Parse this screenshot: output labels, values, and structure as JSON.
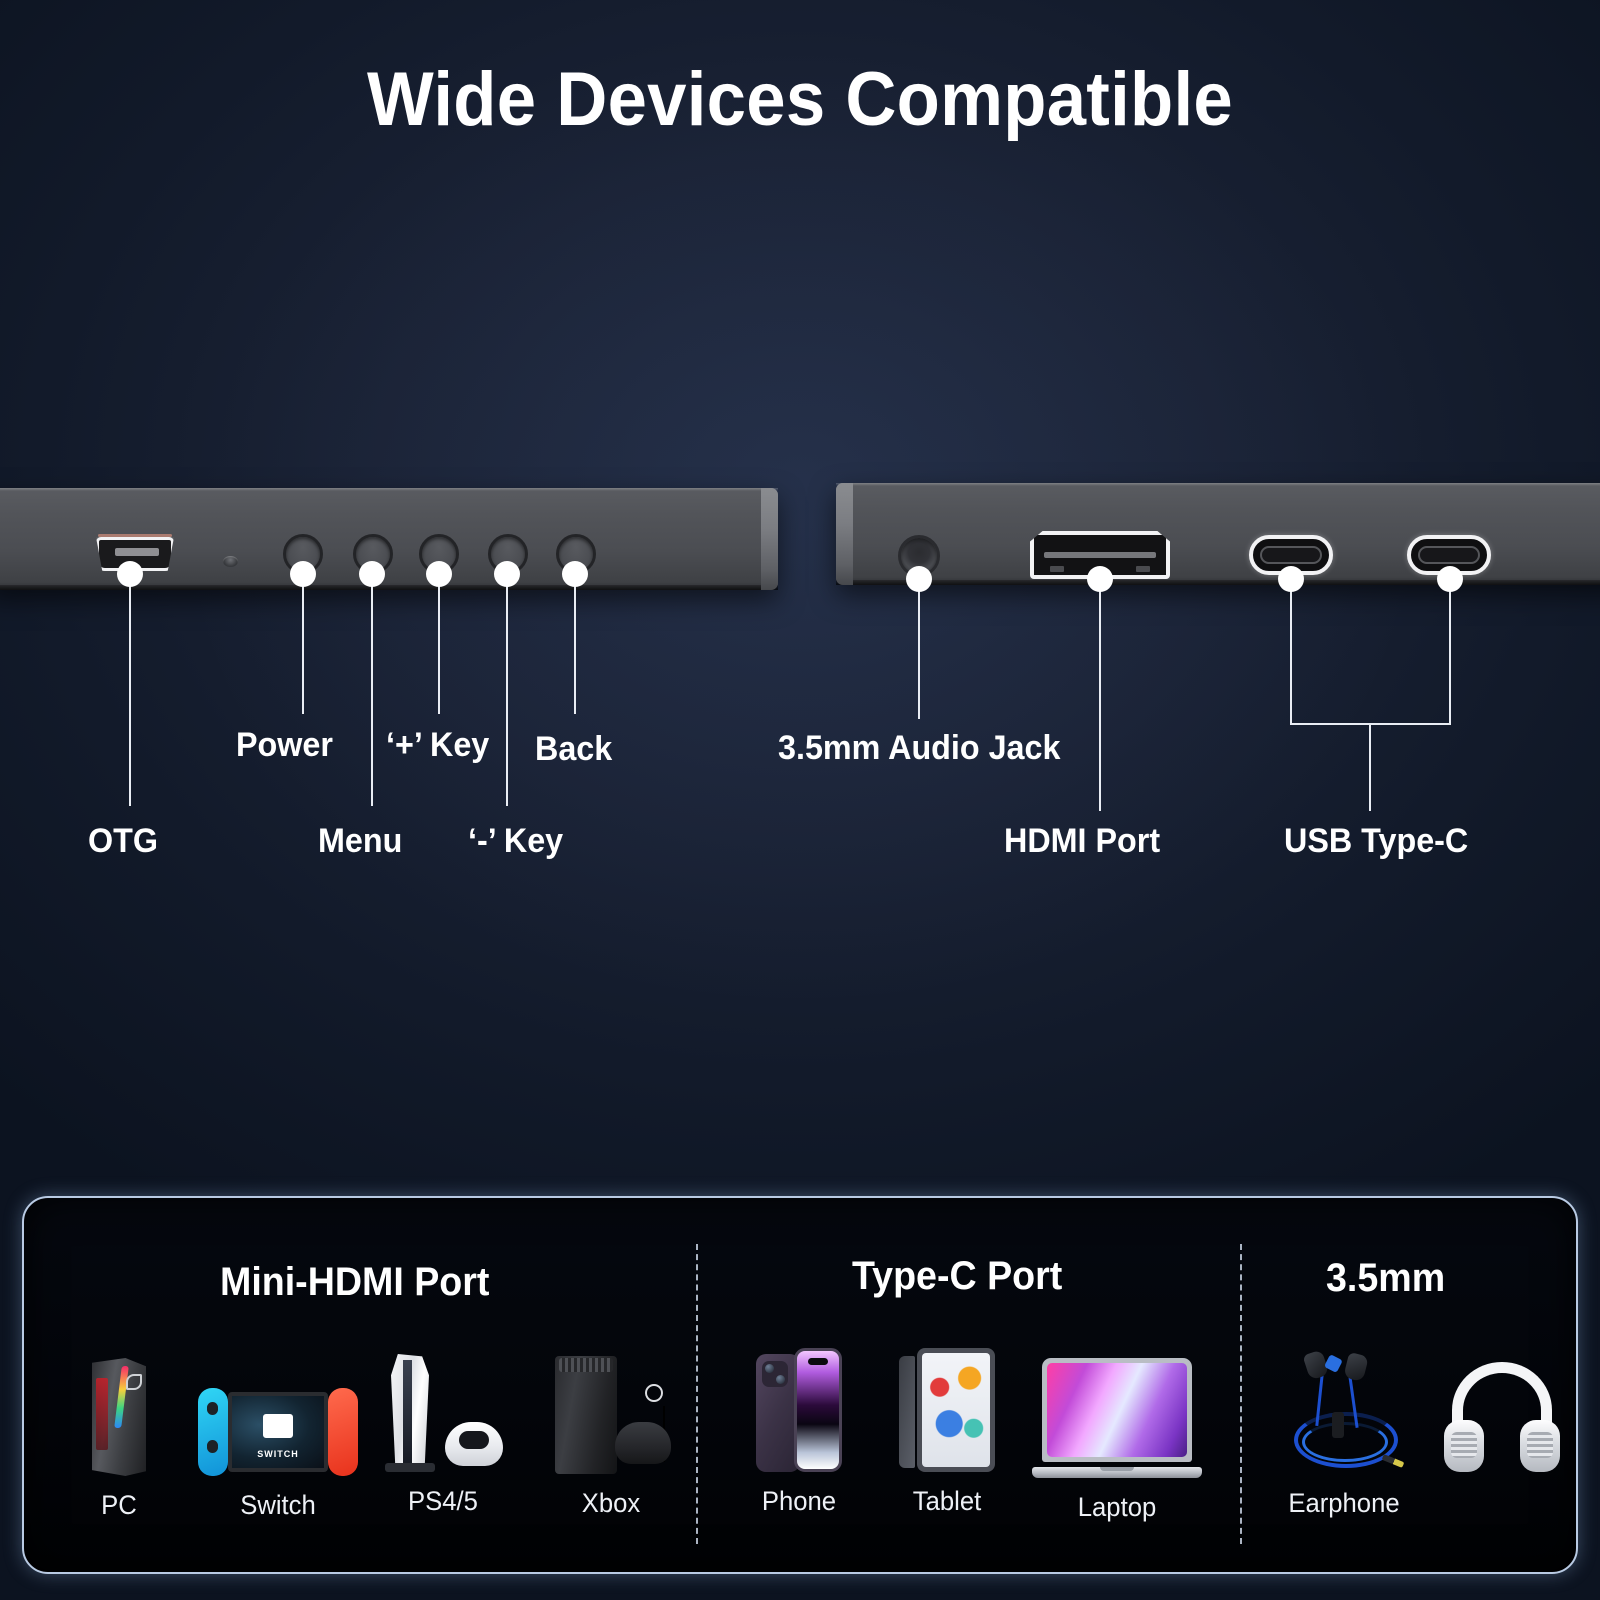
{
  "title": "Wide Devices Compatible",
  "colors": {
    "background_dark": "#0c1320",
    "background_mid": "#1a2235",
    "panel_border": "#b9cbe4",
    "callout_line": "#e9edf4",
    "text": "#ffffff"
  },
  "callouts": {
    "left": [
      {
        "id": "otg",
        "label": "OTG"
      },
      {
        "id": "power",
        "label": "Power"
      },
      {
        "id": "menu",
        "label": "Menu"
      },
      {
        "id": "plus-key",
        "label": "‘+’ Key"
      },
      {
        "id": "minus-key",
        "label": "‘-’ Key"
      },
      {
        "id": "back",
        "label": "Back"
      }
    ],
    "right": [
      {
        "id": "audio-jack",
        "label": "3.5mm Audio Jack"
      },
      {
        "id": "hdmi-port",
        "label": "HDMI Port"
      },
      {
        "id": "usb-type-c",
        "label": "USB Type-C"
      }
    ]
  },
  "compatibility": {
    "groups": [
      {
        "id": "mini-hdmi",
        "title": "Mini-HDMI Port",
        "devices": [
          {
            "id": "pc",
            "label": "PC",
            "icon": "desktop-tower-icon"
          },
          {
            "id": "switch",
            "label": "Switch",
            "icon": "nintendo-switch-icon"
          },
          {
            "id": "ps45",
            "label": "PS4/5",
            "icon": "playstation-console-icon"
          },
          {
            "id": "xbox",
            "label": "Xbox",
            "icon": "xbox-console-icon"
          }
        ]
      },
      {
        "id": "type-c",
        "title": "Type-C  Port",
        "devices": [
          {
            "id": "phone",
            "label": "Phone",
            "icon": "smartphone-icon"
          },
          {
            "id": "tablet",
            "label": "Tablet",
            "icon": "tablet-icon"
          },
          {
            "id": "laptop",
            "label": "Laptop",
            "icon": "laptop-icon"
          }
        ]
      },
      {
        "id": "audio-35mm",
        "title": "3.5mm",
        "devices": [
          {
            "id": "earphone",
            "label": "Earphone",
            "icon": "earbuds-icon"
          },
          {
            "id": "headphone",
            "label": "",
            "icon": "headphones-icon"
          }
        ]
      }
    ]
  },
  "switch_brand": {
    "wordmark": "SWITCH"
  }
}
